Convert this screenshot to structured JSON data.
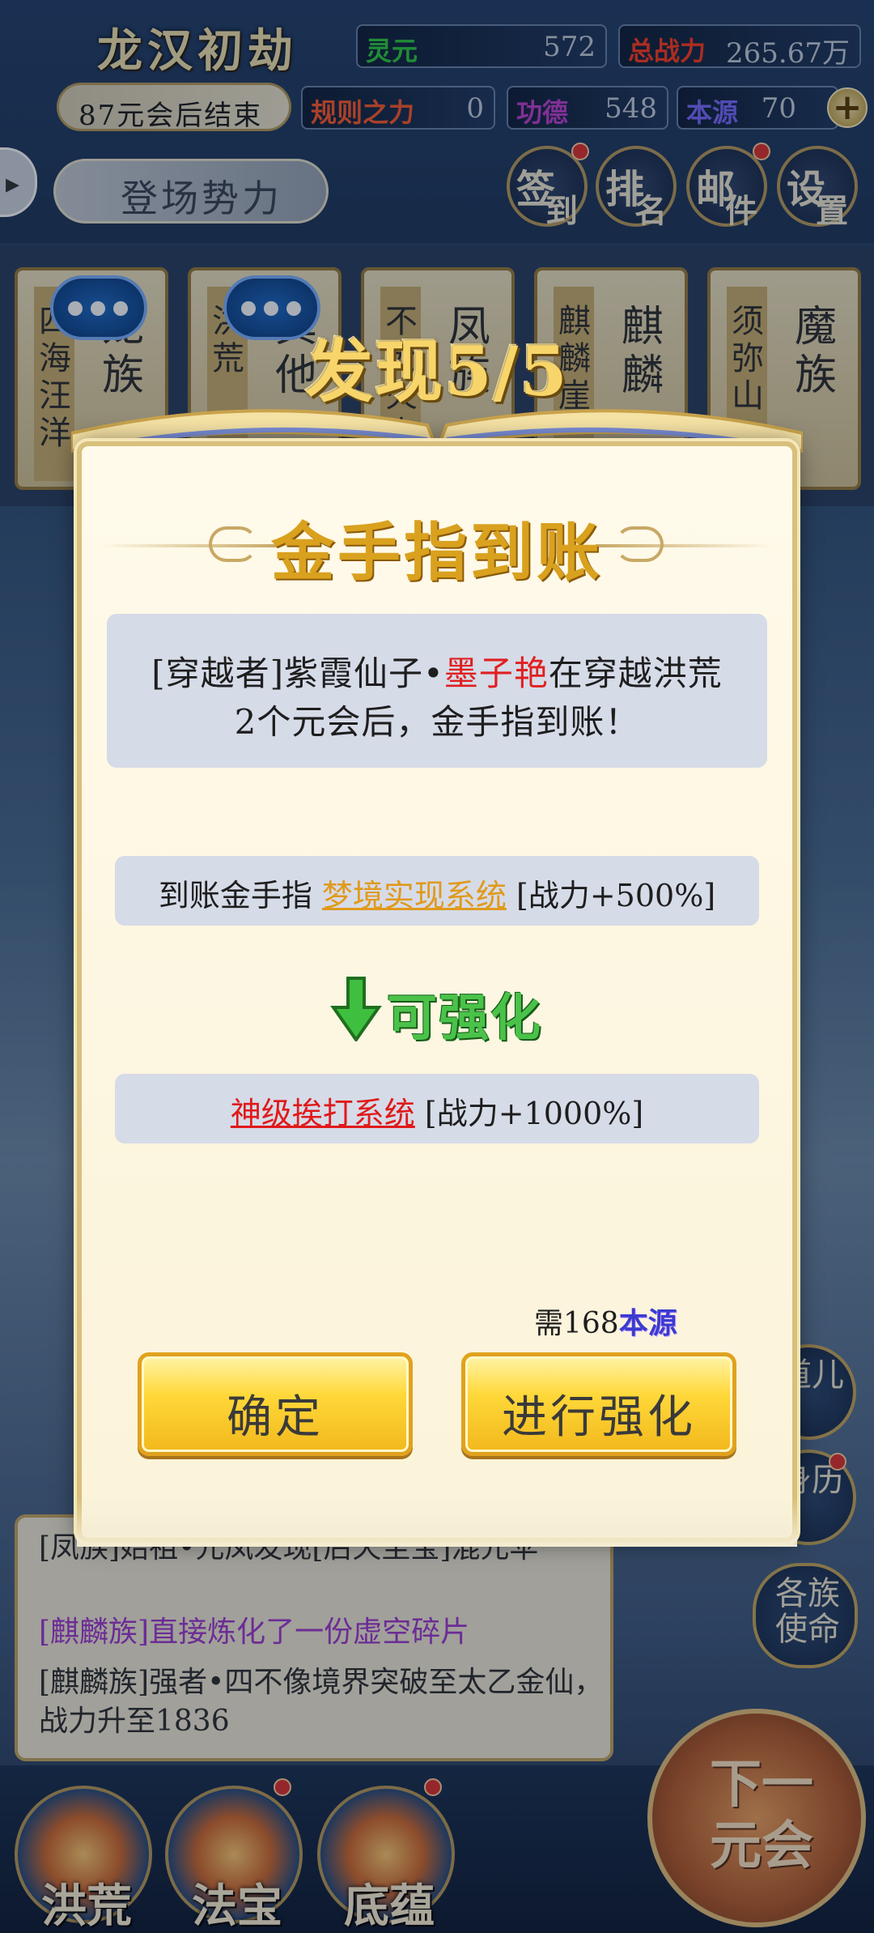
{
  "header": {
    "game_title": "龙汉初劫",
    "era_status": "87元会后结束",
    "stats": [
      {
        "label": "灵元",
        "value": "572",
        "color": "#2ecc40"
      },
      {
        "label": "总战力",
        "value": "265.67万",
        "color": "#ff3b1f"
      },
      {
        "label": "规则之力",
        "value": "0",
        "color": "#ff5a2a"
      },
      {
        "label": "功德",
        "value": "548",
        "color": "#c040d0"
      },
      {
        "label": "本源",
        "value": "70",
        "color": "#7a6bff"
      }
    ],
    "faction_button": "登场势力",
    "side_icon": "▸",
    "menu": [
      {
        "c1": "签",
        "c2": "到"
      },
      {
        "c1": "排",
        "c2": "名"
      },
      {
        "c1": "邮",
        "c2": "件"
      },
      {
        "c1": "设",
        "c2": "置"
      }
    ]
  },
  "race_cards": [
    {
      "v1": "四海汪洋",
      "v2": "龙族"
    },
    {
      "v1": "洪荒",
      "v2": "其他"
    },
    {
      "v1": "不死火山",
      "v2": "凤族"
    },
    {
      "v1": "麒麟崖",
      "v2": "麒麟"
    },
    {
      "v1": "须弥山",
      "v2": "魔族"
    }
  ],
  "modal": {
    "headline": "发现5/5",
    "title": "金手指到账",
    "info_line1_pre": "[穿越者]紫霞仙子•",
    "info_line1_name": "墨子艳",
    "info_line1_post": "在穿越洪荒",
    "info_line2": "2个元会后，金手指到账！",
    "gf_prefix": "到账金手指 ",
    "gf_name": "梦境实现系统",
    "gf_bonus": " [战力+500%]",
    "upgrade_label": "可强化",
    "up_name": "神级挨打系统",
    "up_bonus": " [战力+1000%]",
    "need_prefix": "需168",
    "need_resource": "本源",
    "confirm_label": "确定",
    "enhance_label": "进行强化"
  },
  "log": {
    "line1": "[凤族]始祖•元凤发现[后天至宝]混元伞",
    "line2": "[麒麟族]直接炼化了一份虚空碎片",
    "line3": "[麒麟族]强者•四不像境界突破至太乙金仙，战力升至1836"
  },
  "right_buttons": [
    "道儿",
    "身历",
    "各族使命"
  ],
  "bottom_nav": [
    "洪荒",
    "法宝",
    "底蕴"
  ],
  "next_button": "下一元会"
}
